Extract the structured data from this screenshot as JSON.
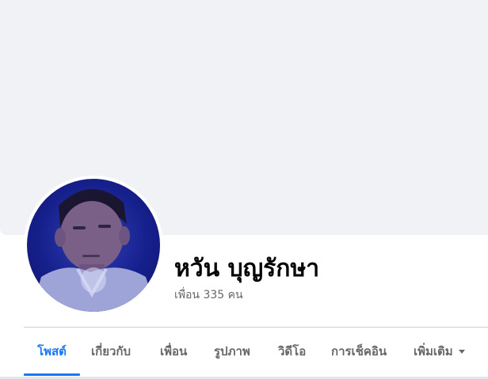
{
  "profile": {
    "name": "หวัน บุญรักษา",
    "friends_label": "เพื่อน 335 คน"
  },
  "tabs": [
    {
      "label": "โพสต์",
      "active": true
    },
    {
      "label": "เกี่ยวกับ",
      "active": false
    },
    {
      "label": "เพื่อน",
      "active": false
    },
    {
      "label": "รูปภาพ",
      "active": false
    },
    {
      "label": "วิดีโอ",
      "active": false
    },
    {
      "label": "การเช็คอิน",
      "active": false
    },
    {
      "label": "เพิ่มเติม",
      "active": false,
      "has_dropdown": true
    }
  ],
  "colors": {
    "accent": "#1877f2",
    "cover_background": "#f0f2f5",
    "secondary_text": "#65676b"
  }
}
